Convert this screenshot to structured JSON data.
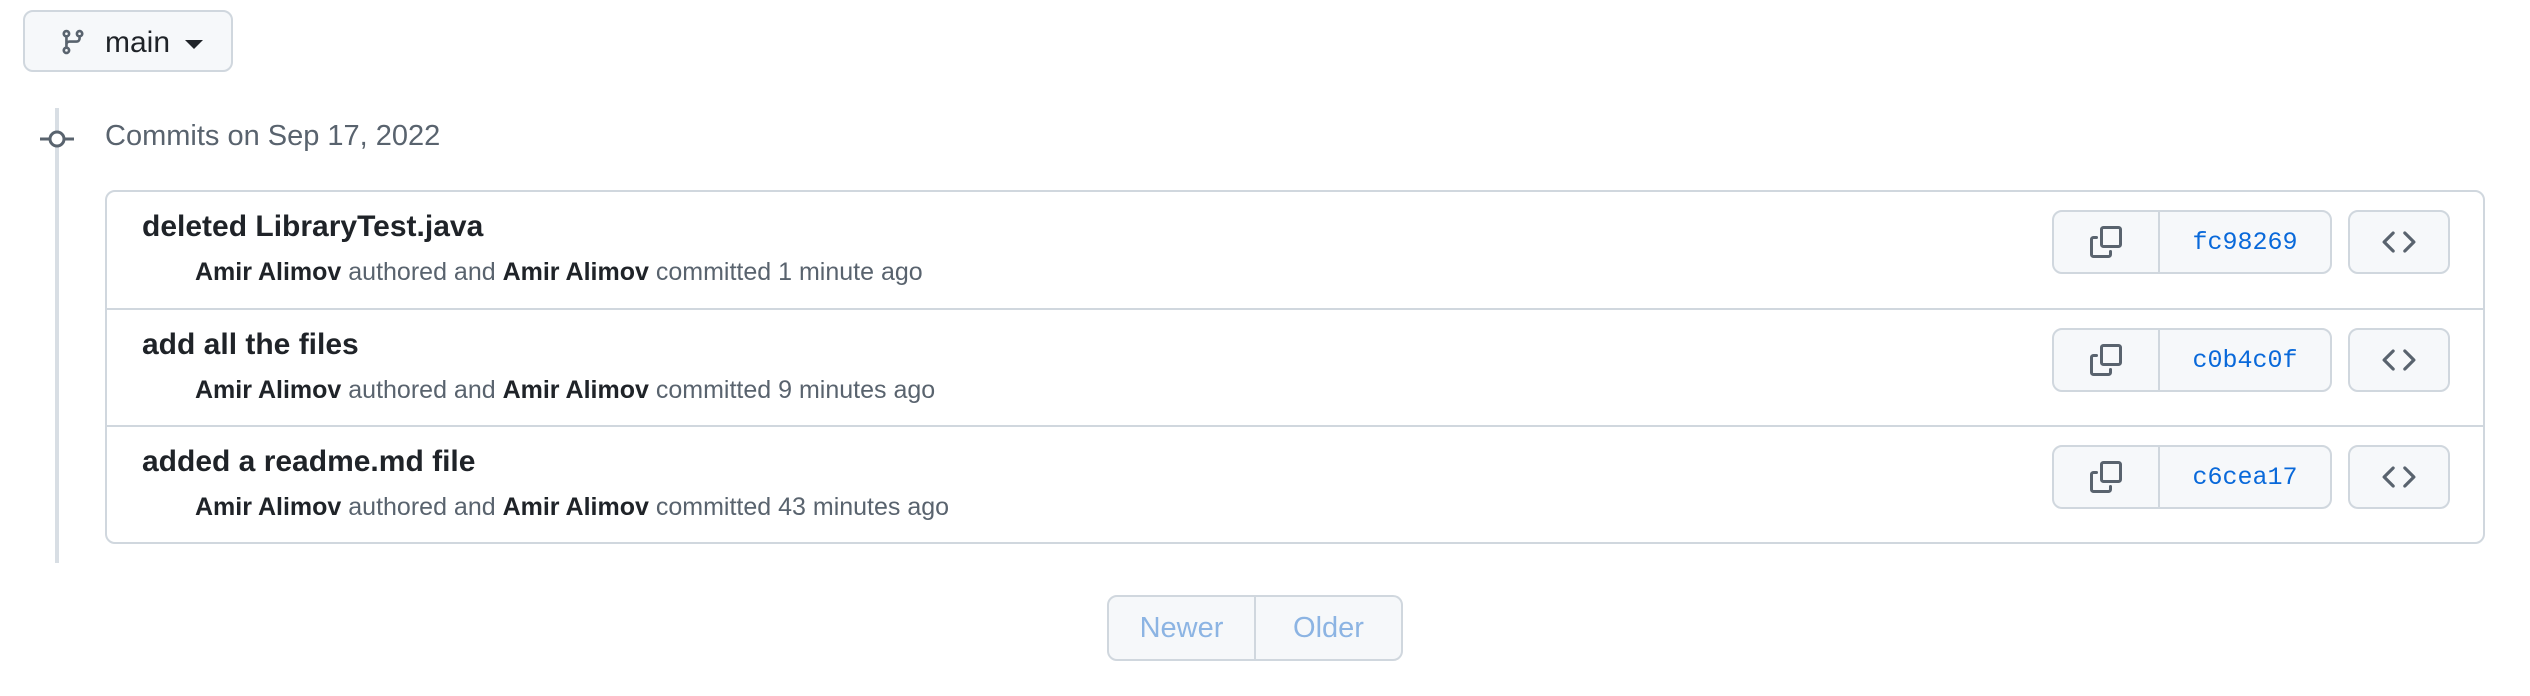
{
  "branch": {
    "label": "main",
    "icon": "git-branch-icon",
    "caret_icon": "triangle-down-icon"
  },
  "timeline": {
    "node_icon": "git-commit-icon",
    "heading": "Commits on Sep 17, 2022"
  },
  "commits": [
    {
      "title": "deleted LibraryTest.java",
      "author": "Amir Alimov",
      "authored_text": " authored and ",
      "committer": "Amir Alimov",
      "committed_text": " committed ",
      "time": "1 minute ago",
      "sha": "fc98269"
    },
    {
      "title": "add all the files",
      "author": "Amir Alimov",
      "authored_text": " authored and ",
      "committer": "Amir Alimov",
      "committed_text": " committed ",
      "time": "9 minutes ago",
      "sha": "c0b4c0f"
    },
    {
      "title": "added a readme.md file",
      "author": "Amir Alimov",
      "authored_text": " authored and ",
      "committer": "Amir Alimov",
      "committed_text": " committed ",
      "time": "43 minutes ago",
      "sha": "c6cea17"
    }
  ],
  "icons": {
    "copy": "copy-icon",
    "browse": "code-icon"
  },
  "pagination": {
    "newer": "Newer",
    "older": "Older"
  },
  "colors": {
    "link": "#0969da",
    "disabled_link": "#8cb4e3",
    "border": "#d0d7de",
    "button_bg": "#f6f8fa"
  }
}
